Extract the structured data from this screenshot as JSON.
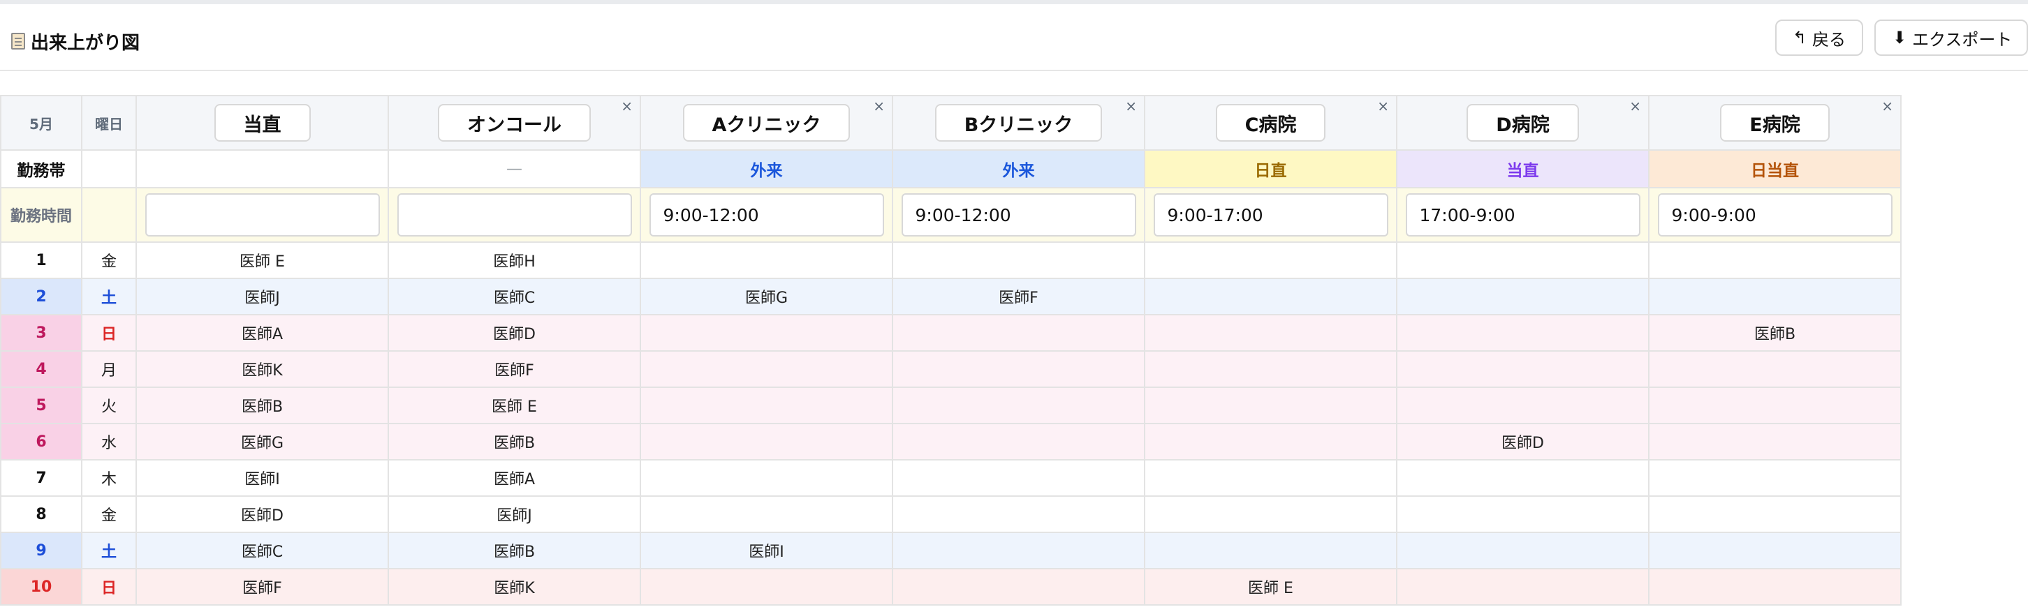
{
  "page": {
    "title": "出来上がり図"
  },
  "toolbar": {
    "back_icon": "↰",
    "back_label": "戻る",
    "export_icon": "⬇",
    "export_label": "エクスポート"
  },
  "table": {
    "month_label": "5月",
    "weekday_header": "曜日",
    "band_label": "勤務帯",
    "hours_label": "勤務時間",
    "columns": [
      {
        "name": "当直",
        "closable": false,
        "band": "",
        "band_bg": "#ffffff",
        "band_color": "#111111",
        "hours": ""
      },
      {
        "name": "オンコール",
        "closable": true,
        "band": "—",
        "band_bg": "#ffffff",
        "band_color": "#9aa0a6",
        "hours": ""
      },
      {
        "name": "Aクリニック",
        "closable": true,
        "band": "外来",
        "band_bg": "#dce9fb",
        "band_color": "#1a56db",
        "hours": "9:00-12:00"
      },
      {
        "name": "Bクリニック",
        "closable": true,
        "band": "外来",
        "band_bg": "#dce9fb",
        "band_color": "#1a56db",
        "hours": "9:00-12:00"
      },
      {
        "name": "C病院",
        "closable": true,
        "band": "日直",
        "band_bg": "#fef8c3",
        "band_color": "#9a6a00",
        "hours": "9:00-17:00"
      },
      {
        "name": "D病院",
        "closable": true,
        "band": "当直",
        "band_bg": "#ece5fb",
        "band_color": "#7c3aed",
        "hours": "17:00-9:00"
      },
      {
        "name": "E病院",
        "closable": true,
        "band": "日当直",
        "band_bg": "#fde9d6",
        "band_color": "#b45309",
        "hours": "9:00-9:00"
      }
    ],
    "rows": [
      {
        "day": "1",
        "weekday": "金",
        "type": "weekday",
        "cells": [
          "医師 E",
          "医師H",
          "",
          "",
          "",
          "",
          ""
        ]
      },
      {
        "day": "2",
        "weekday": "土",
        "type": "saturday",
        "cells": [
          "医師J",
          "医師C",
          "医師G",
          "医師F",
          "",
          "",
          ""
        ]
      },
      {
        "day": "3",
        "weekday": "日",
        "type": "holiday",
        "cells": [
          "医師A",
          "医師D",
          "",
          "",
          "",
          "",
          "医師B"
        ]
      },
      {
        "day": "4",
        "weekday": "月",
        "type": "holiday",
        "cells": [
          "医師K",
          "医師F",
          "",
          "",
          "",
          "",
          ""
        ]
      },
      {
        "day": "5",
        "weekday": "火",
        "type": "holiday",
        "cells": [
          "医師B",
          "医師 E",
          "",
          "",
          "",
          "",
          ""
        ]
      },
      {
        "day": "6",
        "weekday": "水",
        "type": "holiday",
        "cells": [
          "医師G",
          "医師B",
          "",
          "",
          "",
          "医師D",
          ""
        ]
      },
      {
        "day": "7",
        "weekday": "木",
        "type": "weekday",
        "cells": [
          "医師I",
          "医師A",
          "",
          "",
          "",
          "",
          ""
        ]
      },
      {
        "day": "8",
        "weekday": "金",
        "type": "weekday",
        "cells": [
          "医師D",
          "医師J",
          "",
          "",
          "",
          "",
          ""
        ]
      },
      {
        "day": "9",
        "weekday": "土",
        "type": "saturday",
        "cells": [
          "医師C",
          "医師B",
          "医師I",
          "",
          "",
          "",
          ""
        ]
      },
      {
        "day": "10",
        "weekday": "日",
        "type": "sunday",
        "cells": [
          "医師F",
          "医師K",
          "",
          "",
          "医師 E",
          "",
          ""
        ]
      }
    ]
  },
  "colors": {
    "saturday_bg": "#eef4fd",
    "saturday_day_bg": "#dbe7fb",
    "saturday_text": "#1d4ed8",
    "holiday_bg": "#fdf1f6",
    "holiday_day_bg": "#f9d1e6",
    "holiday_day_text": "#be185d",
    "holiday_weekday_text": "#dc2626",
    "sunday_bg": "#fdeeee",
    "sunday_day_bg": "#fbd6d6",
    "sunday_text": "#dc2626",
    "close_icon": "#5a6675"
  }
}
